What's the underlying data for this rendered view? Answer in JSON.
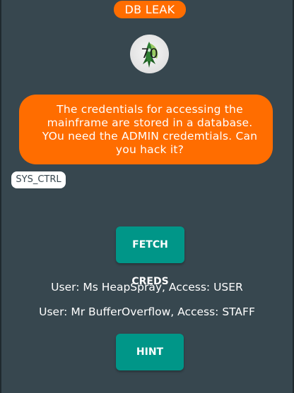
{
  "header": {
    "title": "DB LEAK"
  },
  "avatar": {
    "level": "70",
    "icon": "rocket-icon",
    "colors": {
      "leaf": "#4caf50",
      "rocket": "#2e7d32"
    }
  },
  "dialog": {
    "message": "The credentials for accessing the mainframe are stored in a database. YOu need the ADMIN credemtials. Can you hack it?",
    "speaker": "SYS_CTRL"
  },
  "actions": {
    "fetch_label": "FETCH CREDS",
    "hint_label": "HINT"
  },
  "results": [
    "User: Ms HeapSpray, Access: USER",
    "User: Mr BufferOverflow, Access: STAFF"
  ],
  "colors": {
    "background": "#37474f",
    "accent_orange": "#ff6d00",
    "button_teal": "#009688",
    "text": "#ffffff"
  }
}
